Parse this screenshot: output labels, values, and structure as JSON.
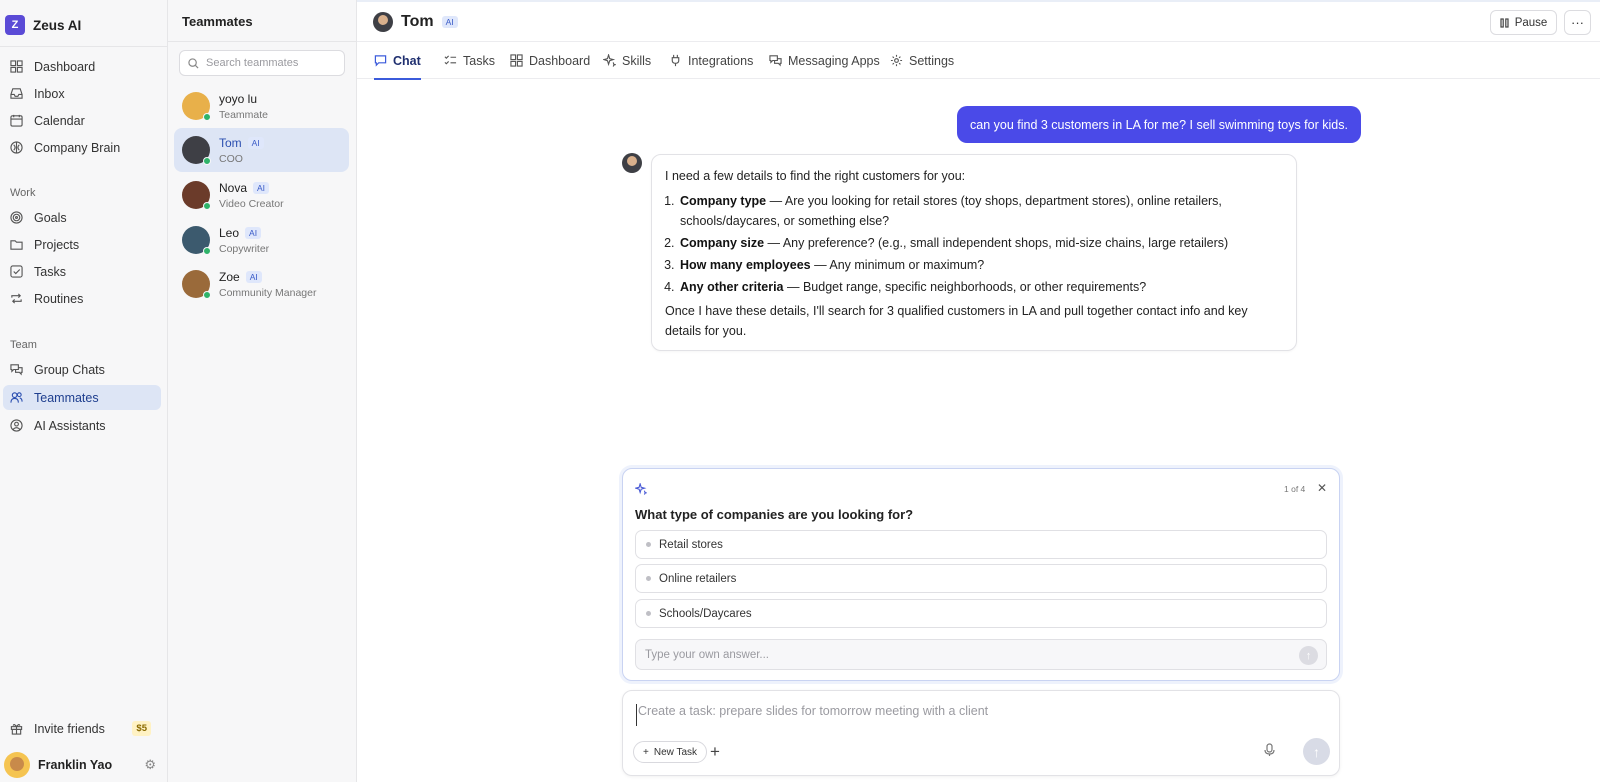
{
  "app": {
    "brand_letter": "Z",
    "brand_name": "Zeus AI"
  },
  "nav": {
    "items": [
      {
        "label": "Dashboard",
        "icon": "grid-icon"
      },
      {
        "label": "Inbox",
        "icon": "inbox-icon"
      },
      {
        "label": "Calendar",
        "icon": "calendar-icon"
      },
      {
        "label": "Company Brain",
        "icon": "brain-icon"
      }
    ],
    "work_label": "Work",
    "work_items": [
      {
        "label": "Goals",
        "icon": "target-icon"
      },
      {
        "label": "Projects",
        "icon": "folder-icon"
      },
      {
        "label": "Tasks",
        "icon": "checkbox-icon"
      },
      {
        "label": "Routines",
        "icon": "repeat-icon"
      }
    ],
    "team_label": "Team",
    "team_items": [
      {
        "label": "Group Chats",
        "icon": "chat-icon"
      },
      {
        "label": "Teammates",
        "icon": "users-icon",
        "active": true
      },
      {
        "label": "AI Assistants",
        "icon": "bot-icon"
      }
    ],
    "invite_label": "Invite friends",
    "invite_badge": "$5",
    "user_name": "Franklin Yao"
  },
  "teammates": {
    "title": "Teammates",
    "search_placeholder": "Search teammates",
    "list": [
      {
        "name": "yoyo lu",
        "role": "Teammate",
        "ai": false,
        "color": "#e8b04a"
      },
      {
        "name": "Tom",
        "role": "COO",
        "ai": true,
        "active": true,
        "color": "#3e3f45"
      },
      {
        "name": "Nova",
        "role": "Video Creator",
        "ai": true,
        "color": "#6b3b2a"
      },
      {
        "name": "Leo",
        "role": "Copywriter",
        "ai": true,
        "color": "#3c5a6e"
      },
      {
        "name": "Zoe",
        "role": "Community Manager",
        "ai": true,
        "color": "#9a6a3a"
      }
    ],
    "ai_tag": "AI"
  },
  "header": {
    "name": "Tom",
    "ai_tag": "AI",
    "pause_label": "Pause",
    "more_label": "···"
  },
  "tabs": [
    {
      "label": "Chat",
      "active": true
    },
    {
      "label": "Tasks"
    },
    {
      "label": "Dashboard"
    },
    {
      "label": "Skills"
    },
    {
      "label": "Integrations"
    },
    {
      "label": "Messaging Apps"
    },
    {
      "label": "Settings"
    }
  ],
  "chat": {
    "user_message": "can you find 3 customers in LA for me? I sell swimming toys for kids.",
    "bot_intro": "I need a few details to find the right customers for you:",
    "bot_list": [
      {
        "bold": "Company type",
        "text": " — Are you looking for retail stores (toy shops, department stores), online retailers, schools/daycares, or something else?"
      },
      {
        "bold": "Company size",
        "text": " — Any preference? (e.g., small independent shops, mid-size chains, large retailers)"
      },
      {
        "bold": "How many employees",
        "text": " — Any minimum or maximum?"
      },
      {
        "bold": "Any other criteria",
        "text": " — Budget range, specific neighborhoods, or other requirements?"
      }
    ],
    "bot_outro": "Once I have these details, I'll search for 3 qualified customers in LA and pull together contact info and key details for you."
  },
  "question": {
    "counter": "1 of 4",
    "text": "What type of companies are you looking for?",
    "options": [
      "Retail stores",
      "Online retailers",
      "Schools/Daycares"
    ],
    "answer_placeholder": "Type your own answer..."
  },
  "composer": {
    "placeholder": "Create a task: prepare slides for tomorrow meeting with a client",
    "new_task_label": "New Task"
  }
}
